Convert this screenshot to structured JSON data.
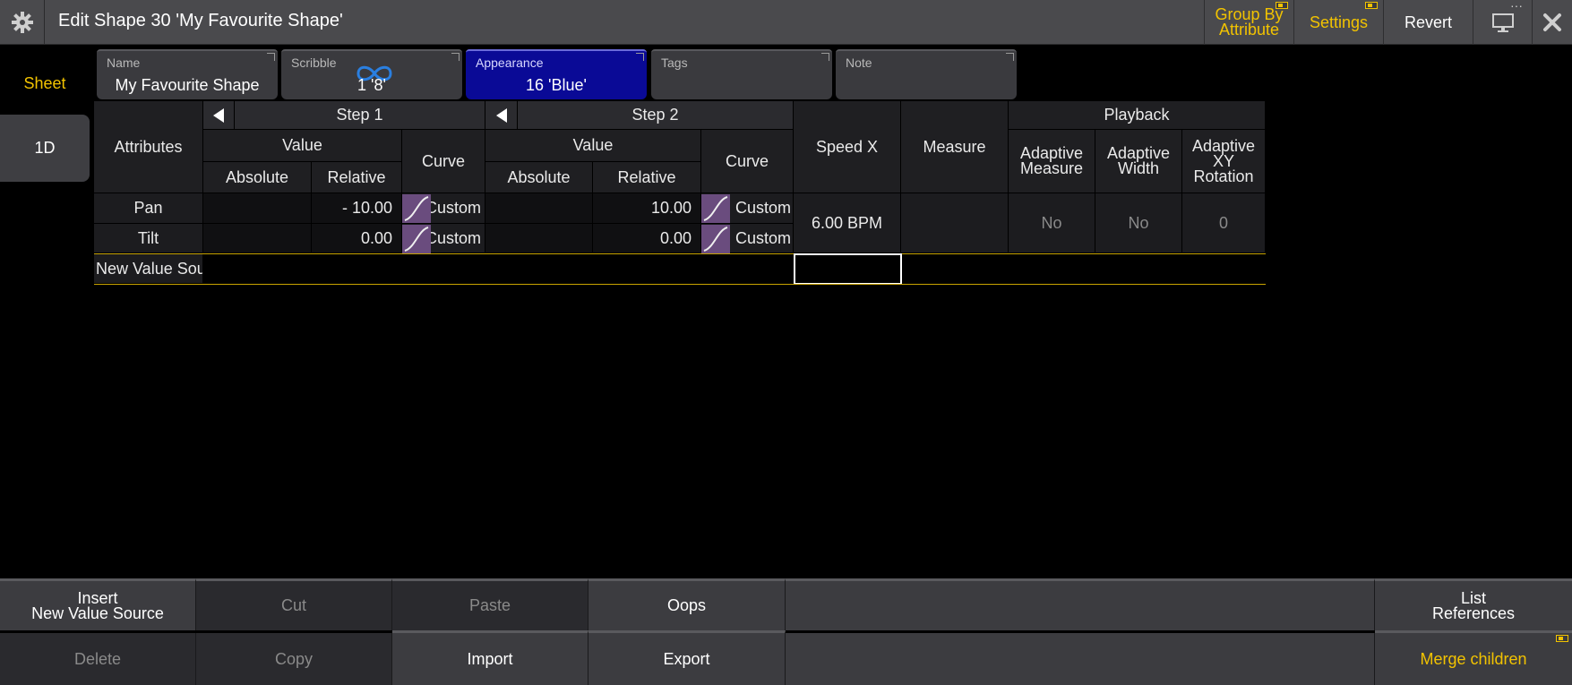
{
  "window": {
    "title": "Edit Shape 30 'My Favourite Shape'",
    "icons": {
      "settings": "gear-icon",
      "display": "monitor-icon",
      "close": "close-icon"
    }
  },
  "toolbar": {
    "group_by_attribute": "Group By\nAttribute",
    "settings": "Settings",
    "revert": "Revert"
  },
  "tabs": {
    "sheet": "Sheet",
    "one_d": "1D"
  },
  "properties": {
    "name": {
      "label": "Name",
      "value": "My Favourite Shape"
    },
    "scribble": {
      "label": "Scribble",
      "value": "1 '8'"
    },
    "appearance": {
      "label": "Appearance",
      "value": "16 'Blue'",
      "color": "#0a0a96"
    },
    "tags": {
      "label": "Tags",
      "value": ""
    },
    "note": {
      "label": "Note",
      "value": ""
    }
  },
  "table": {
    "attributes_header": "Attributes",
    "step1": "Step 1",
    "step2": "Step 2",
    "value": "Value",
    "absolute": "Absolute",
    "relative": "Relative",
    "curve": "Curve",
    "speed_x": "Speed X",
    "measure": "Measure",
    "playback": "Playback",
    "adaptive_measure": "Adaptive\nMeasure",
    "adaptive_width": "Adaptive\nWidth",
    "adaptive_xy_rotation": "Adaptive\nXY Rotation",
    "rows": [
      {
        "attribute": "Pan",
        "step1_relative": "- 10.00",
        "step1_curve": "Custom",
        "step2_relative": "10.00",
        "step2_curve": "Custom"
      },
      {
        "attribute": "Tilt",
        "step1_relative": "0.00",
        "step1_curve": "Custom",
        "step2_relative": "0.00",
        "step2_curve": "Custom"
      }
    ],
    "speed_value": "6.00 BPM",
    "adaptive_measure_value": "No",
    "adaptive_width_value": "No",
    "adaptive_xy_rotation_value": "0",
    "new_row": "New Value Sou"
  },
  "bottom": {
    "insert": "Insert\nNew Value Source",
    "cut": "Cut",
    "paste": "Paste",
    "oops": "Oops",
    "list_references": "List\nReferences",
    "delete": "Delete",
    "copy": "Copy",
    "import": "Import",
    "export": "Export",
    "merge_children": "Merge children"
  },
  "colors": {
    "accent": "#f2c300",
    "curve": "#6a4c7e"
  }
}
